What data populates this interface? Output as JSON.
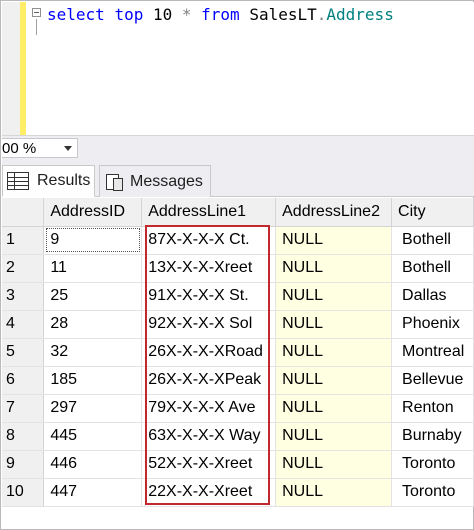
{
  "editor": {
    "query_tokens": [
      {
        "text": "select",
        "cls": "kw"
      },
      {
        "text": " ",
        "cls": "id"
      },
      {
        "text": "top",
        "cls": "kw"
      },
      {
        "text": " 10 ",
        "cls": "id"
      },
      {
        "text": "*",
        "cls": "op"
      },
      {
        "text": " ",
        "cls": "id"
      },
      {
        "text": "from",
        "cls": "kw"
      },
      {
        "text": " SalesLT",
        "cls": "id"
      },
      {
        "text": ".",
        "cls": "op"
      },
      {
        "text": "Address",
        "cls": "tbl"
      }
    ]
  },
  "status": {
    "zoom": "00 %"
  },
  "tabs": {
    "results": "Results",
    "messages": "Messages"
  },
  "grid": {
    "columns": [
      "AddressID",
      "AddressLine1",
      "AddressLine2",
      "City"
    ],
    "rows": [
      {
        "n": "1",
        "id": "9",
        "line1": "87X-X-X-X Ct.",
        "line2": "NULL",
        "city": "Bothell"
      },
      {
        "n": "2",
        "id": "11",
        "line1": "13X-X-X-Xreet",
        "line2": "NULL",
        "city": "Bothell"
      },
      {
        "n": "3",
        "id": "25",
        "line1": "91X-X-X-X St.",
        "line2": "NULL",
        "city": "Dallas"
      },
      {
        "n": "4",
        "id": "28",
        "line1": "92X-X-X-X Sol",
        "line2": "NULL",
        "city": "Phoenix"
      },
      {
        "n": "5",
        "id": "32",
        "line1": "26X-X-X-XRoad",
        "line2": "NULL",
        "city": "Montreal"
      },
      {
        "n": "6",
        "id": "185",
        "line1": "26X-X-X-XPeak",
        "line2": "NULL",
        "city": "Bellevue"
      },
      {
        "n": "7",
        "id": "297",
        "line1": "79X-X-X-X Ave",
        "line2": "NULL",
        "city": "Renton"
      },
      {
        "n": "8",
        "id": "445",
        "line1": "63X-X-X-X Way",
        "line2": "NULL",
        "city": "Burnaby"
      },
      {
        "n": "9",
        "id": "446",
        "line1": "52X-X-X-Xreet",
        "line2": "NULL",
        "city": "Toronto"
      },
      {
        "n": "10",
        "id": "447",
        "line1": "22X-X-X-Xreet",
        "line2": "NULL",
        "city": "Toronto"
      }
    ]
  },
  "colors": {
    "highlight_box": "#c0282d",
    "null_cell_bg": "#ffffe1",
    "keyword": "#0000ff",
    "table_name": "#008080"
  }
}
